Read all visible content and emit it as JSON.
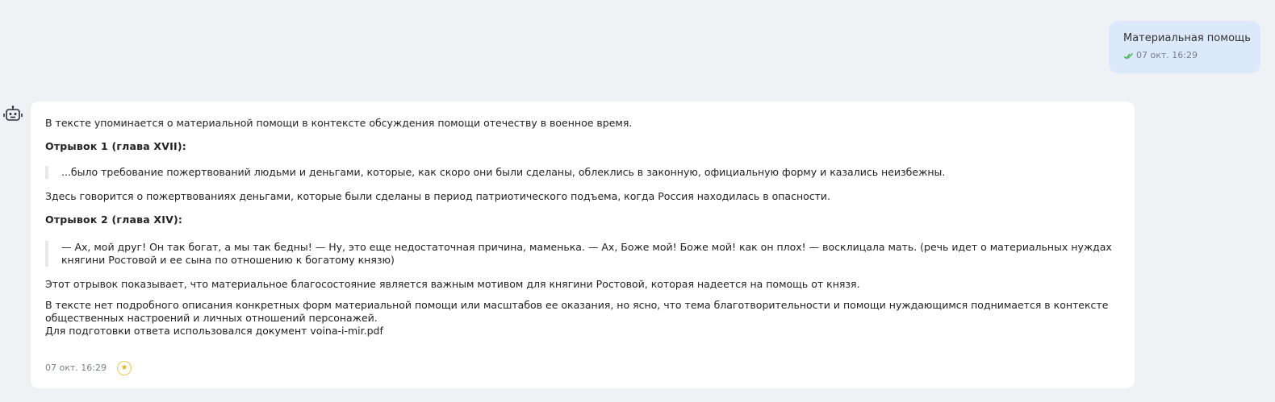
{
  "user_message": {
    "text": "Материальная помощь",
    "timestamp": "07 окт. 16:29",
    "status_icon": "double-check-icon",
    "status_color": "#3fb950"
  },
  "bot_message": {
    "avatar_icon": "robot-icon",
    "intro": "В тексте упоминается о материальной помощи в контексте обсуждения помощи отечеству в военное время.",
    "excerpt1_heading": "Отрывок 1 (глава XVII):",
    "excerpt1_quote": "...было требование пожертвований людьми и деньгами, которые, как скоро они были сделаны, облеклись в законную, официальную форму и казались неизбежны.",
    "excerpt1_comment": "Здесь говорится о пожертвованиях деньгами, которые были сделаны в период патриотического подъема, когда Россия находилась в опасности.",
    "excerpt2_heading": "Отрывок 2 (глава XIV):",
    "excerpt2_quote_line1": "— Ах, мой друг! Он так богат, а мы так бедны! — Ну, это еще недостаточная причина, маменька. — Ах, Боже мой! Боже мой! как он плох! — восклицала мать. (речь идет о материальных нуждах",
    "excerpt2_quote_line2": "княгини Ростовой и ее сына по отношению к богатому князю)",
    "excerpt2_comment": "Этот отрывок показывает, что материальное благосостояние является важным мотивом для княгини Ростовой, которая надеется на помощь от князя.",
    "conclusion_line1": "В тексте нет подробного описания конкретных форм материальной помощи или масштабов ее оказания, но ясно, что тема благотворительности и помощи нуждающимся поднимается в контексте",
    "conclusion_line2": "общественных настроений и личных отношений персонажей.",
    "source_note": "Для подготовки ответа использовался документ voina-i-mir.pdf",
    "timestamp": "07 окт. 16:29",
    "badge_icon": "star-badge-icon",
    "badge_color": "#e0b520"
  }
}
